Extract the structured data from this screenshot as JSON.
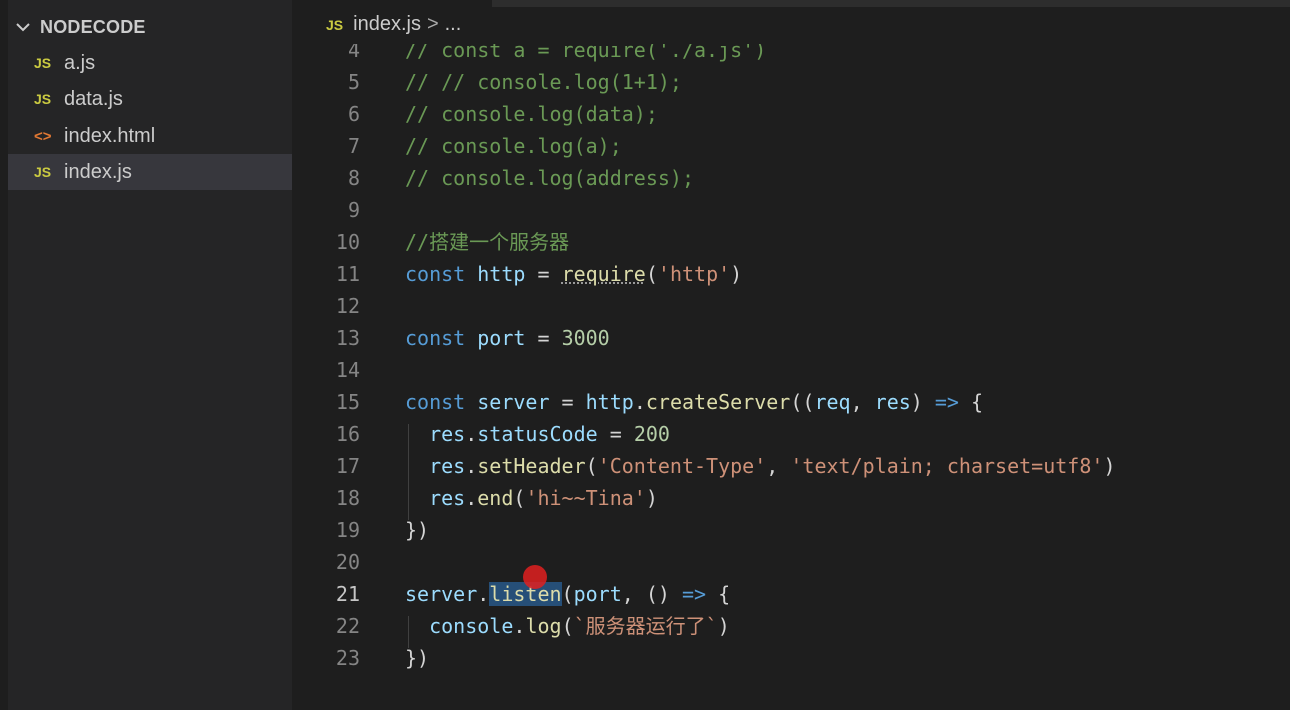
{
  "explorer": {
    "title": "NODECODE",
    "files": [
      {
        "icon": "JS",
        "name": "a.js"
      },
      {
        "icon": "JS",
        "name": "data.js"
      },
      {
        "icon": "<>",
        "name": "index.html"
      },
      {
        "icon": "JS",
        "name": "index.js"
      }
    ]
  },
  "breadcrumb": {
    "icon": "JS",
    "file": "index.js",
    "sep": ">",
    "more": "..."
  },
  "editor": {
    "lines": [
      {
        "n": "4"
      },
      {
        "n": "5"
      },
      {
        "n": "6"
      },
      {
        "n": "7"
      },
      {
        "n": "8"
      },
      {
        "n": "9"
      },
      {
        "n": "10"
      },
      {
        "n": "11"
      },
      {
        "n": "12"
      },
      {
        "n": "13"
      },
      {
        "n": "14"
      },
      {
        "n": "15"
      },
      {
        "n": "16"
      },
      {
        "n": "17"
      },
      {
        "n": "18"
      },
      {
        "n": "19"
      },
      {
        "n": "20"
      },
      {
        "n": "21"
      },
      {
        "n": "22"
      },
      {
        "n": "23"
      }
    ],
    "t": {
      "l4": "// const a = require('./a.js')",
      "l5": "// // console.log(1+1);",
      "l6": "// console.log(data);",
      "l7": "// console.log(a);",
      "l8": "// console.log(address);",
      "l10": "//搭建一个服务器",
      "kw_const": "const",
      "v_http": "http",
      "op_eq": " = ",
      "fn_require": "require",
      "str_http": "'http'",
      "v_port": "port",
      "num_3000": "3000",
      "v_server": "server",
      "fn_createServer": "createServer",
      "v_req": "req",
      "v_res": "res",
      "arrow": "=>",
      "v_statusCode": "statusCode",
      "num_200": "200",
      "fn_setHeader": "setHeader",
      "str_ct": "'Content-Type'",
      "str_tp": "'text/plain; charset=utf8'",
      "fn_end": "end",
      "str_hi": "'hi~~Tina'",
      "fn_listen": "listen",
      "v_console": "console",
      "fn_log": "log",
      "str_run": "`服务器运行了`"
    }
  }
}
